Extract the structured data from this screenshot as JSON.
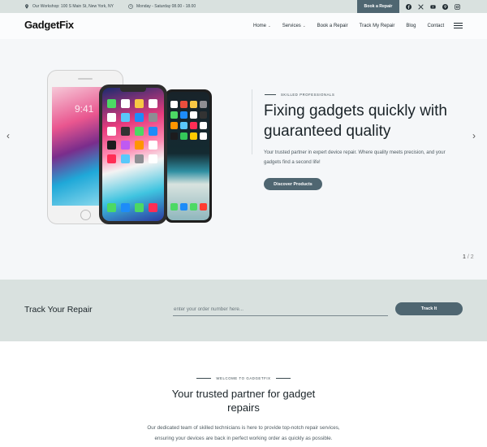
{
  "topbar": {
    "address": "Our Workshop: 100 S Main St, New York, NY",
    "hours": "Monday - Saturday 08.00 - 18.00",
    "book_label": "Book a Repair",
    "socials": [
      "facebook-icon",
      "x-icon",
      "youtube-icon",
      "pinterest-icon",
      "instagram-icon"
    ]
  },
  "header": {
    "logo": "GadgetFix",
    "nav": [
      {
        "label": "Home",
        "dropdown": true
      },
      {
        "label": "Services",
        "dropdown": true
      },
      {
        "label": "Book a Repair",
        "dropdown": false
      },
      {
        "label": "Track My Repair",
        "dropdown": false
      },
      {
        "label": "Blog",
        "dropdown": false
      },
      {
        "label": "Contact",
        "dropdown": false
      }
    ]
  },
  "hero": {
    "eyebrow": "SKILLED PROFESSIONALS",
    "title": "Fixing gadgets quickly with guaranteed quality",
    "description": "Your trusted partner in expert device repair. Where quality meets precision, and your gadgets find a second life!",
    "cta_label": "Discover Products",
    "slide_current": "1",
    "slide_total": "2",
    "phone_time": "9:41"
  },
  "track": {
    "title": "Track Your Repair",
    "placeholder": "enter your order number here...",
    "button_label": "Track It"
  },
  "welcome": {
    "eyebrow": "WELCOME TO GADGETFIX",
    "title": "Your trusted partner for gadget repairs",
    "description": "Our dedicated team of skilled technicians is here to provide top-notch repair services, ensuring your devices are back in perfect working order as quickly as possible."
  },
  "colors": {
    "accent": "#4f6671",
    "band": "#d9e1df",
    "hero_bg": "#f5f7f9"
  }
}
